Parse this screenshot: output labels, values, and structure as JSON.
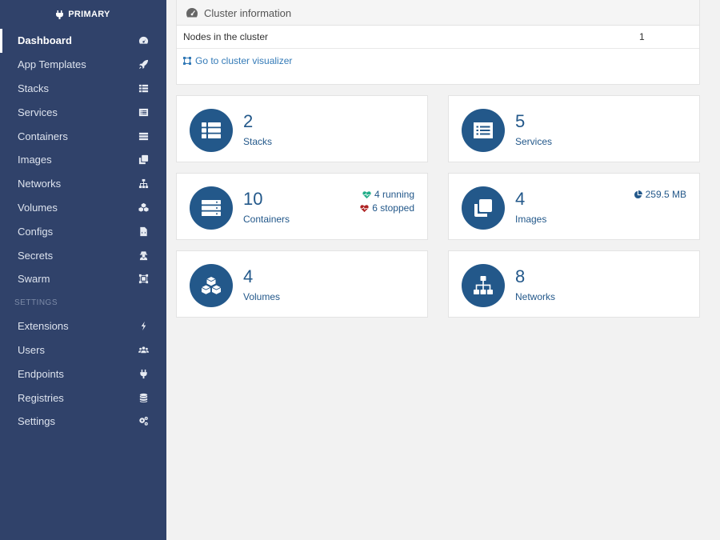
{
  "sidebar": {
    "endpoint_name": "PRIMARY",
    "items": [
      {
        "label": "Dashboard",
        "icon": "tachometer-icon"
      },
      {
        "label": "App Templates",
        "icon": "rocket-icon"
      },
      {
        "label": "Stacks",
        "icon": "th-list-icon"
      },
      {
        "label": "Services",
        "icon": "list-alt-icon"
      },
      {
        "label": "Containers",
        "icon": "server-icon"
      },
      {
        "label": "Images",
        "icon": "clone-icon"
      },
      {
        "label": "Networks",
        "icon": "sitemap-icon"
      },
      {
        "label": "Volumes",
        "icon": "cubes-icon"
      },
      {
        "label": "Configs",
        "icon": "file-code-icon"
      },
      {
        "label": "Secrets",
        "icon": "user-secret-icon"
      },
      {
        "label": "Swarm",
        "icon": "object-group-icon"
      }
    ],
    "settings_title": "SETTINGS",
    "settings_items": [
      {
        "label": "Extensions",
        "icon": "bolt-icon"
      },
      {
        "label": "Users",
        "icon": "users-icon"
      },
      {
        "label": "Endpoints",
        "icon": "plug-icon"
      },
      {
        "label": "Registries",
        "icon": "database-icon"
      },
      {
        "label": "Settings",
        "icon": "cogs-icon"
      }
    ]
  },
  "cluster": {
    "title": "Cluster information",
    "nodes_label": "Nodes in the cluster",
    "nodes_value": "1",
    "visualizer_link": "Go to cluster visualizer"
  },
  "tiles": {
    "stacks": {
      "count": "2",
      "label": "Stacks"
    },
    "services": {
      "count": "5",
      "label": "Services"
    },
    "containers": {
      "count": "10",
      "label": "Containers",
      "running": "4 running",
      "stopped": "6 stopped"
    },
    "images": {
      "count": "4",
      "label": "Images",
      "size": "259.5 MB"
    },
    "volumes": {
      "count": "4",
      "label": "Volumes"
    },
    "networks": {
      "count": "8",
      "label": "Networks"
    }
  },
  "colors": {
    "sidebar_bg": "#30426a",
    "accent": "#23588a",
    "running": "#23ae89",
    "stopped": "#ae2323"
  }
}
